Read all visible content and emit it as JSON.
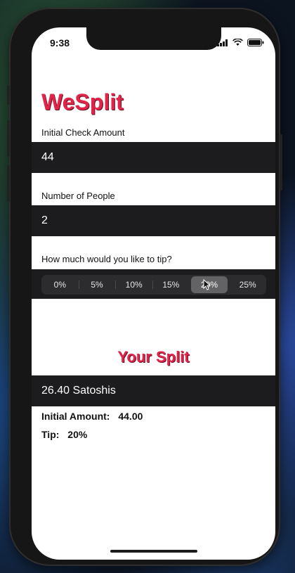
{
  "status_bar": {
    "time": "9:38"
  },
  "app": {
    "title": "WeSplit"
  },
  "check_amount": {
    "label": "Initial Check Amount",
    "value": "44"
  },
  "people": {
    "label": "Number of People",
    "value": "2"
  },
  "tip": {
    "label": "How much would you like to tip?",
    "options": [
      "0%",
      "5%",
      "10%",
      "15%",
      "20%",
      "25%"
    ],
    "selected": "20%"
  },
  "split": {
    "title": "Your Split",
    "result": "26.40 Satoshis",
    "initial_amount_label": "Initial Amount:",
    "initial_amount_value": "44.00",
    "tip_label": "Tip:",
    "tip_value": "20%"
  },
  "colors": {
    "accent": "#e0244a",
    "field_bg": "#1c1c1e",
    "segment_selected": "#636366"
  }
}
